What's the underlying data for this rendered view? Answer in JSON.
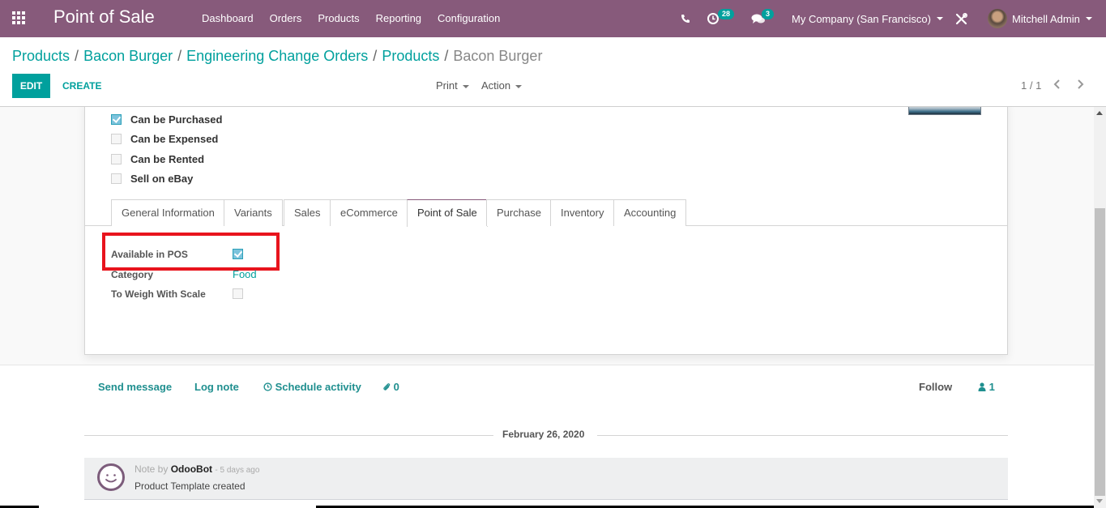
{
  "navbar": {
    "app_title": "Point of Sale",
    "menu": [
      "Dashboard",
      "Orders",
      "Products",
      "Reporting",
      "Configuration"
    ],
    "activity_count": "28",
    "message_count": "3",
    "company": "My Company (San Francisco)",
    "user": "Mitchell Admin",
    "color": "#875a7b"
  },
  "breadcrumb": {
    "items": [
      "Products",
      "Bacon Burger",
      "Engineering Change Orders",
      "Products"
    ],
    "current": "Bacon Burger",
    "separator": "/"
  },
  "toolbar": {
    "edit_label": "EDIT",
    "create_label": "CREATE",
    "print_label": "Print",
    "action_label": "Action",
    "pager": "1 / 1",
    "accent": "#00a09d"
  },
  "form": {
    "checkboxes": [
      {
        "label": "Can be Purchased",
        "checked": true
      },
      {
        "label": "Can be Expensed",
        "checked": false
      },
      {
        "label": "Can be Rented",
        "checked": false
      },
      {
        "label": "Sell on eBay",
        "checked": false
      }
    ],
    "tabs": [
      "General Information",
      "Variants",
      "Sales",
      "eCommerce",
      "Point of Sale",
      "Purchase",
      "Inventory",
      "Accounting"
    ],
    "active_tab": "Point of Sale",
    "pos_fields": {
      "available_label": "Available in POS",
      "available_checked": true,
      "category_label": "Category",
      "category_value": "Food",
      "weigh_label": "To Weigh With Scale",
      "weigh_checked": false
    },
    "highlight_color": "#e8141d"
  },
  "chatter": {
    "send_message": "Send message",
    "log_note": "Log note",
    "schedule_activity": "Schedule activity",
    "attachments": "0",
    "follow": "Follow",
    "followers": "1",
    "date_separator": "February 26, 2020",
    "messages": [
      {
        "prefix": "Note by",
        "author": "OdooBot",
        "time": "- 5 days ago",
        "body": "Product Template created"
      }
    ]
  }
}
